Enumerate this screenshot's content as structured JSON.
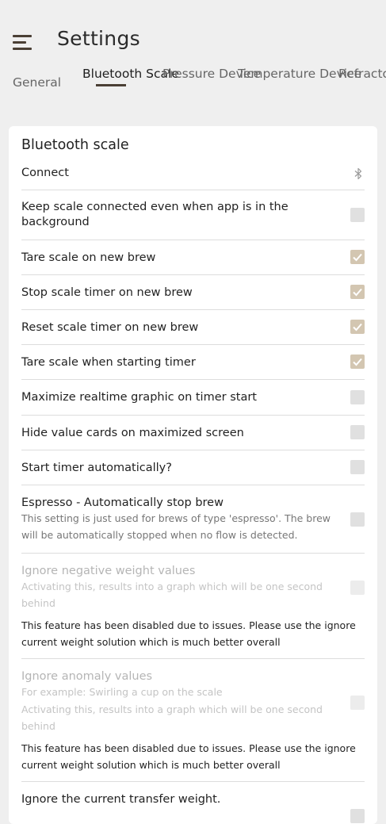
{
  "header": {
    "title": "Settings"
  },
  "tabs": [
    {
      "label": "General",
      "active": false
    },
    {
      "label": "Bluetooth Scale",
      "active": true
    },
    {
      "label": "Pressure Device",
      "active": false
    },
    {
      "label": "Temperature Device",
      "active": false
    },
    {
      "label": "Refractometer Device",
      "active": false
    }
  ],
  "card": {
    "title": "Bluetooth scale",
    "connect_label": "Connect",
    "connect_icon": "bluetooth-icon",
    "rows": [
      {
        "label": "Keep scale connected even when app is in the background",
        "checked": false
      },
      {
        "label": "Tare scale on new brew",
        "checked": true
      },
      {
        "label": "Stop scale timer on new brew",
        "checked": true
      },
      {
        "label": "Reset scale timer on new brew",
        "checked": true
      },
      {
        "label": "Tare scale when starting timer",
        "checked": true
      },
      {
        "label": "Maximize realtime graphic on timer start",
        "checked": false
      },
      {
        "label": "Hide value cards on maximized screen",
        "checked": false
      },
      {
        "label": "Start timer automatically?",
        "checked": false
      },
      {
        "label": "Espresso - Automatically stop brew",
        "description": "This setting is just used for brews of type 'espresso'. The brew will be automatically stopped when no flow is detected.",
        "checked": false
      },
      {
        "label": "Ignore negative weight values",
        "description": "Activating this, results into a graph which will be one second behind",
        "note": "This feature has been disabled due to issues. Please use the ignore current weight solution which is much better overall",
        "checked": false,
        "disabled": true
      },
      {
        "label": "Ignore anomaly values",
        "description_1": "For example: Swirling a cup on the scale",
        "description_2": "Activating this, results into a graph which will be one second behind",
        "note": "This feature has been disabled due to issues. Please use the ignore current weight solution which is much better overall",
        "checked": false,
        "disabled": true
      },
      {
        "label": "Ignore the current transfer weight.",
        "checked": false
      }
    ]
  },
  "colors": {
    "background": "#efefef",
    "card": "#ffffff",
    "accent": "#4a3f35",
    "checkbox_checked": "#d3c6b1",
    "checkbox_unchecked": "#e0e0e0",
    "disabled_text": "#b5b5b5"
  }
}
